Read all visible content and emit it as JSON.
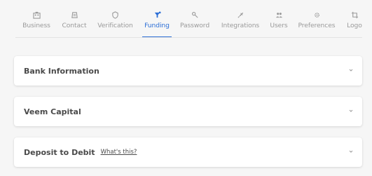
{
  "tabs": [
    {
      "label": "Business",
      "icon": "building-icon",
      "active": false
    },
    {
      "label": "Contact",
      "icon": "contact-icon",
      "active": false
    },
    {
      "label": "Verification",
      "icon": "shield-icon",
      "active": false
    },
    {
      "label": "Funding",
      "icon": "funding-icon",
      "active": true
    },
    {
      "label": "Password",
      "icon": "key-icon",
      "active": false
    },
    {
      "label": "Integrations",
      "icon": "plug-icon",
      "active": false
    },
    {
      "label": "Users",
      "icon": "users-icon",
      "active": false
    },
    {
      "label": "Preferences",
      "icon": "gear-icon",
      "active": false
    },
    {
      "label": "Logo",
      "icon": "crop-icon",
      "active": false
    }
  ],
  "sections": [
    {
      "title": "Bank Information",
      "link": ""
    },
    {
      "title": "Veem Capital",
      "link": ""
    },
    {
      "title": "Deposit to Debit",
      "link": "What's this?"
    }
  ],
  "colors": {
    "accent": "#2d6fd6",
    "muted": "#9a9a9a",
    "background": "#f6f6f6"
  }
}
